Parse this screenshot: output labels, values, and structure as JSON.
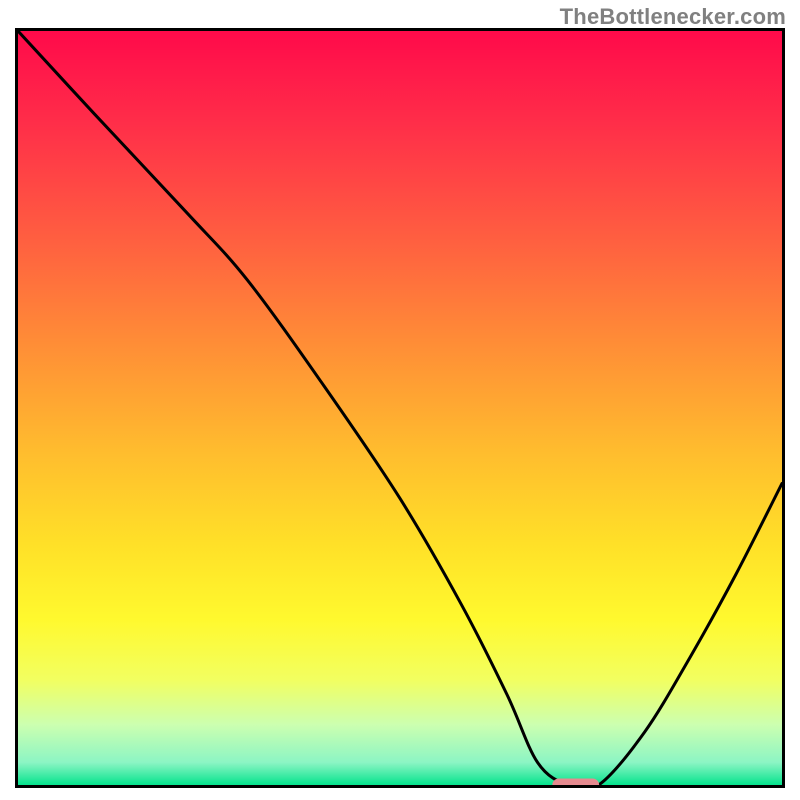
{
  "header": {
    "watermark": "TheBottlenecker.com"
  },
  "colors": {
    "gradient_stops": [
      {
        "offset": 0.0,
        "color": "#ff0a4a"
      },
      {
        "offset": 0.12,
        "color": "#ff2d49"
      },
      {
        "offset": 0.28,
        "color": "#ff6040"
      },
      {
        "offset": 0.42,
        "color": "#ff8f36"
      },
      {
        "offset": 0.56,
        "color": "#ffbd2e"
      },
      {
        "offset": 0.68,
        "color": "#ffe028"
      },
      {
        "offset": 0.78,
        "color": "#fff92e"
      },
      {
        "offset": 0.86,
        "color": "#f2ff60"
      },
      {
        "offset": 0.92,
        "color": "#ccffb0"
      },
      {
        "offset": 0.97,
        "color": "#8cf5c4"
      },
      {
        "offset": 1.0,
        "color": "#05e38d"
      }
    ],
    "curve": "#000000",
    "marker_fill": "#e58a8f",
    "marker_stroke": "#e58a8f",
    "frame": "#000000",
    "background": "#ffffff"
  },
  "chart_data": {
    "type": "line",
    "title": "",
    "xlabel": "",
    "ylabel": "",
    "xlim": [
      0,
      100
    ],
    "ylim": [
      0,
      100
    ],
    "x": [
      0,
      10,
      22,
      30,
      40,
      50,
      58,
      64,
      68,
      72,
      76,
      82,
      88,
      94,
      100
    ],
    "values": [
      100,
      89,
      76,
      67,
      53,
      38,
      24,
      12,
      3,
      0,
      0,
      7,
      17,
      28,
      40
    ],
    "optimum_marker": {
      "x_start": 70,
      "x_end": 76,
      "y": 0
    }
  }
}
